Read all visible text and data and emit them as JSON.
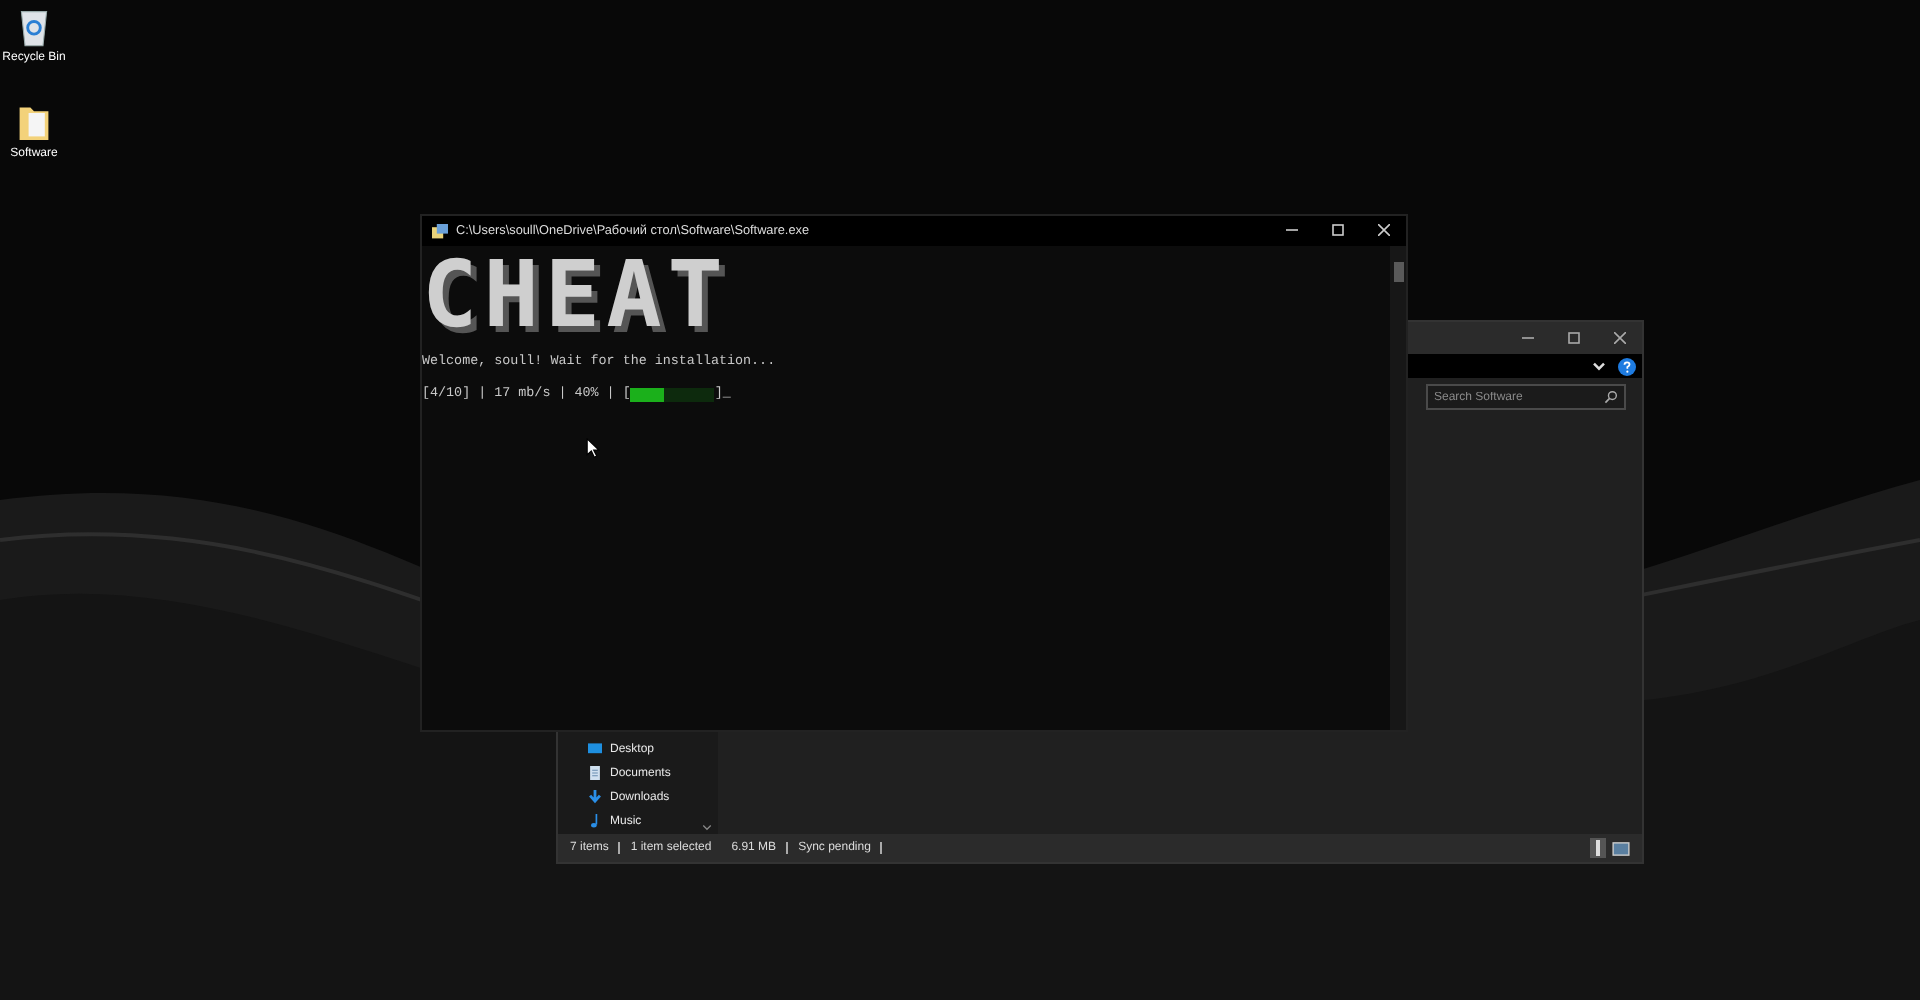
{
  "desktop_icons": [
    {
      "label": "Recycle Bin",
      "kind": "recycle-bin"
    },
    {
      "label": "Software",
      "kind": "folder"
    }
  ],
  "console": {
    "title": "C:\\Users\\soull\\OneDrive\\Рабочий стол\\Software\\Software.exe",
    "banner": "CHEAT",
    "welcome": "Welcome, soull! Wait for the installation...",
    "progress": {
      "prefix": "[4/10] | 17 mb/s | 40% | [",
      "level": 0.4,
      "suffix": "]",
      "cursor": "_"
    }
  },
  "explorer": {
    "search": {
      "placeholder": "Search Software"
    },
    "nav_items": [
      {
        "label": "Desktop",
        "kind": "desktop"
      },
      {
        "label": "Documents",
        "kind": "documents"
      },
      {
        "label": "Downloads",
        "kind": "downloads"
      },
      {
        "label": "Music",
        "kind": "music"
      }
    ],
    "status_bar": [
      "7 items",
      "1 item selected",
      "6.91 MB",
      "Sync pending"
    ]
  }
}
